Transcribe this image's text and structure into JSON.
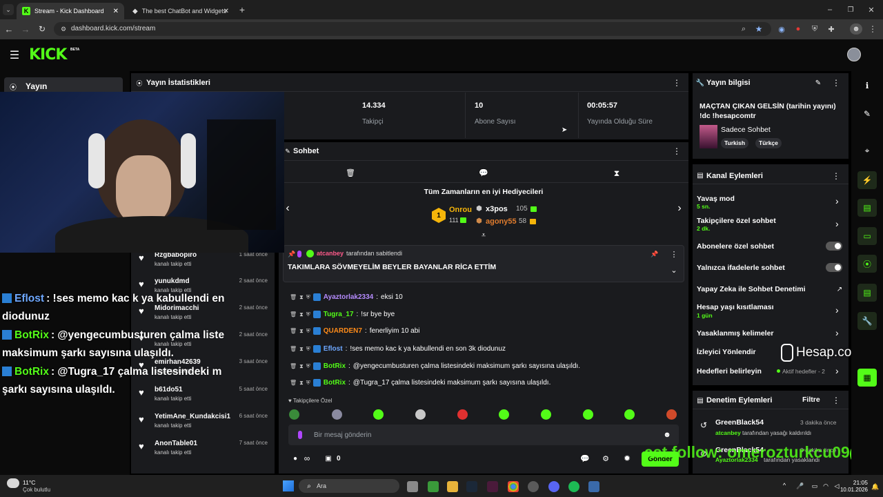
{
  "browser": {
    "tabs": [
      {
        "title": "Stream - Kick Dashboard"
      },
      {
        "title": "The best ChatBot and Widgets"
      }
    ],
    "url": "dashboard.kick.com/stream"
  },
  "app": {
    "logo": "KICK",
    "logo_badge": "BETA"
  },
  "sidebar": {
    "item": "Yayın"
  },
  "stats": {
    "title": "Yayın İstatistikleri",
    "followers_value": "14.334",
    "followers_label": "Takipçi",
    "subs_value": "10",
    "subs_label": "Abone Sayısı",
    "uptime_value": "00:05:57",
    "uptime_label": "Yayında Olduğu Süre"
  },
  "chat": {
    "title": "Sohbet",
    "gifters_title": "Tüm Zamanların en iyi Hediyecileri",
    "gifters": [
      {
        "rank": "1",
        "name": "Onrou",
        "count": "111"
      },
      {
        "name": "x3pos",
        "count": "105"
      },
      {
        "name": "agony55",
        "count": "58"
      }
    ],
    "pinned_by_user": "atcanbey",
    "pinned_by_text": "tarafından sabitlendi",
    "pinned_message": "TAKIMLARA SÖVMEYELİM BEYLER BAYANLAR RİCA ETTİM",
    "messages": [
      {
        "user": "Ayaztorlak2334",
        "text": "eksi 10",
        "color": "#b68cff"
      },
      {
        "user": "Tugra_17",
        "text": "!sr bye bye",
        "color": "#53fc18"
      },
      {
        "user": "QUARDEN7",
        "text": "fenerliyim 10 abi",
        "color": "#ff8c1a"
      },
      {
        "user": "Eflost",
        "text": "!ses memo kac k ya kabullendi en son 3k diodunuz",
        "color": "#6ea8ff"
      },
      {
        "user": "BotRix",
        "text": "@yengecumbusturen çalma listesindeki maksimum şarkı sayısına ulaşıldı.",
        "color": "#53fc18"
      },
      {
        "user": "BotRix",
        "text": "@Tugra_17 çalma listesindeki maksimum şarkı sayısına ulaşıldı.",
        "color": "#53fc18"
      }
    ],
    "followers_only_label": "Takipçilere Özel",
    "input_placeholder": "Bir mesaj gönderin",
    "count_value": "0",
    "send_label": "Gönder"
  },
  "followers_list": [
    {
      "name": "Rzgbabopiro",
      "action": "kanalı takip etti",
      "time": "1 saat önce"
    },
    {
      "name": "yunukdmd",
      "action": "kanalı takip etti",
      "time": "2 saat önce"
    },
    {
      "name": "Midorimacchi",
      "action": "kanalı takip etti",
      "time": "2 saat önce"
    },
    {
      "name": "",
      "action": "kanalı takip etti",
      "time": "2 saat önce"
    },
    {
      "name": "emirhan42639",
      "action": "kanalı takip etti",
      "time": "3 saat önce"
    },
    {
      "name": "b61do51",
      "action": "kanalı takip etti",
      "time": "5 saat önce"
    },
    {
      "name": "YetimAne_Kundakcisi1",
      "action": "kanalı takip etti",
      "time": "6 saat önce"
    },
    {
      "name": "AnonTable01",
      "action": "kanalı takip etti",
      "time": "7 saat önce"
    }
  ],
  "overlay_chat": [
    {
      "user": "Eflost",
      "text": ": !ses memo kac k ya kabullendi en",
      "cont": "diodunuz"
    },
    {
      "user": "BotRix",
      "text": ": @yengecumbusturen çalma liste",
      "cont": "maksimum şarkı sayısına ulaşıldı."
    },
    {
      "user": "BotRix",
      "text": ": @Tugra_17 çalma listesindeki m",
      "cont": "şarkı sayısına ulaşıldı."
    }
  ],
  "stream_info": {
    "title": "Yayın bilgisi",
    "stream_title": "MAÇTAN ÇIKAN GELSİN (tarihin yayını) !dc !hesapcomtr",
    "category": "Sadece Sohbet",
    "tags": [
      "Turkish",
      "Türkçe"
    ]
  },
  "channel_actions": {
    "title": "Kanal Eylemleri",
    "slow_mode": "Yavaş mod",
    "slow_mode_value": "5 sn.",
    "followers_chat": "Takipçilere özel sohbet",
    "followers_chat_value": "2 dk.",
    "subs_chat": "Abonelere özel sohbet",
    "emotes_chat": "Yalnızca ifadelerle sohbet",
    "ai_moderation": "Yapay Zeka ile Sohbet Denetimi",
    "age_restriction": "Hesap yaşı kısıtlaması",
    "age_restriction_value": "1 gün",
    "banned_words": "Yasaklanmış kelimeler",
    "viewer_redirect": "İzleyici Yönlendir",
    "goals": "Hedefleri belirleyin",
    "goals_value": "Aktif hedefler - 2"
  },
  "mod_actions": {
    "title": "Denetim Eylemleri",
    "filter": "Filtre",
    "items": [
      {
        "mod": "GreenBlack54",
        "time": "3 dakika önce",
        "target": "atcanbey",
        "text": "tarafından yasağı kaldırıldı"
      },
      {
        "mod": "GreenBlack54",
        "time": "3 dakika önce",
        "target": "Ayaztorlak2334",
        "text": "tarafından yasaklandı"
      }
    ]
  },
  "watermark": "Hesap.com.tr",
  "ticker": "ast follow: omerozturkcu09",
  "taskbar": {
    "weather_temp": "11°C",
    "weather_desc": "Çok bulutlu",
    "search": "Ara",
    "time": "21:05",
    "date": "10.01.2026"
  }
}
